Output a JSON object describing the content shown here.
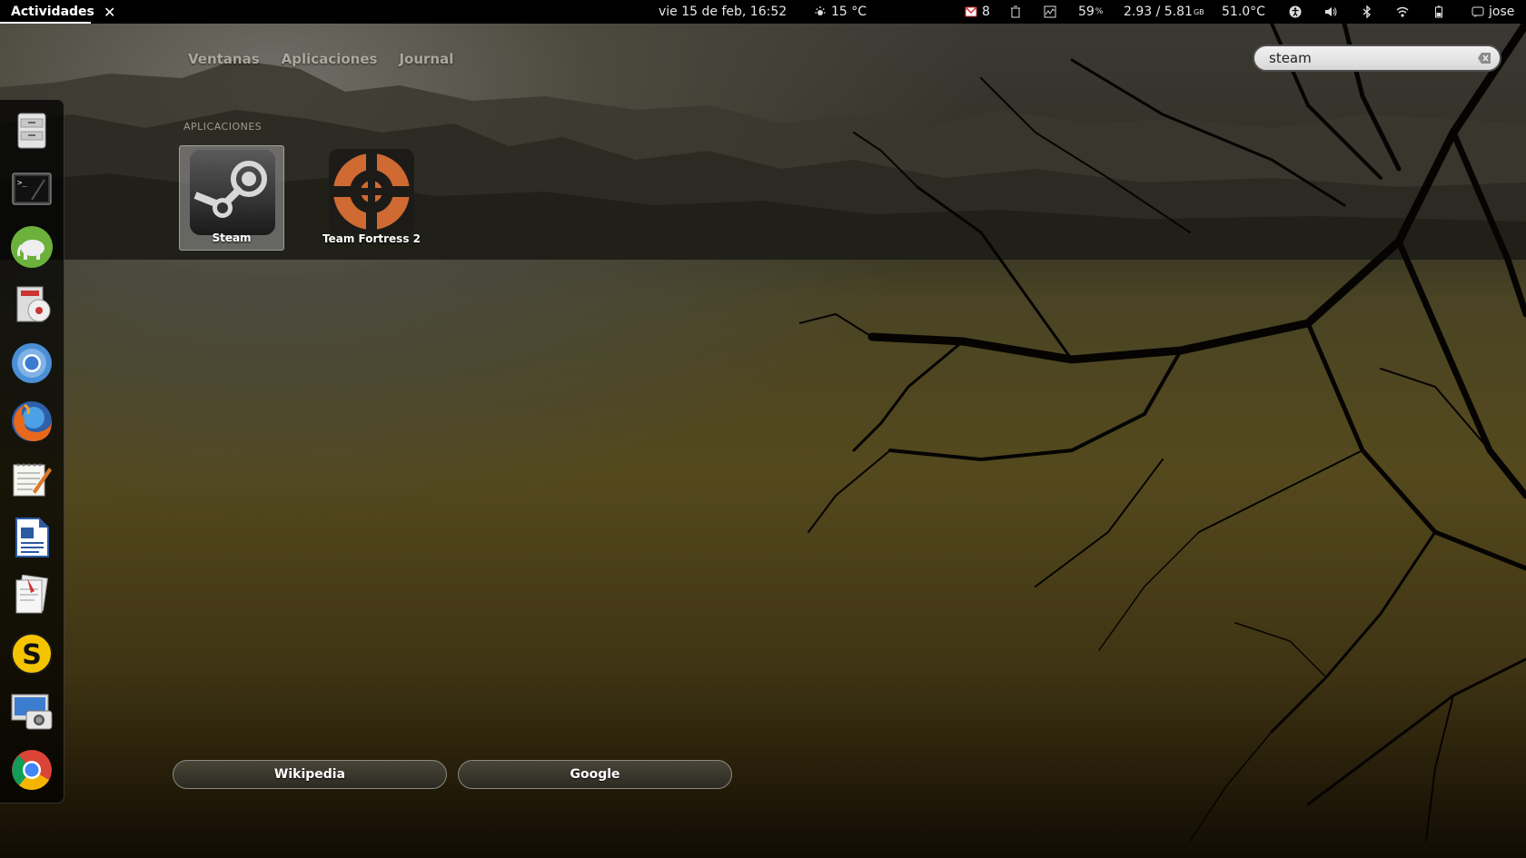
{
  "topbar": {
    "activities": "Actividades",
    "close_symbol": "✕",
    "clock": "vie 15 de feb, 16:52",
    "weather": "15 °C",
    "gmail_count": "8",
    "cpu_percent": "59",
    "cpu_unit": "%",
    "load": "2.93 / 5.81",
    "load_unit": "GB",
    "temperature": "51.0°C",
    "user": "jose"
  },
  "tabs": [
    "Ventanas",
    "Aplicaciones",
    "Journal"
  ],
  "search": {
    "value": "steam"
  },
  "results": {
    "section": "APLICACIONES",
    "apps": [
      {
        "label": "Steam",
        "icon": "steam-icon"
      },
      {
        "label": "Team Fortress 2",
        "icon": "tf2-icon"
      }
    ]
  },
  "providers": [
    "Wikipedia",
    "Google"
  ],
  "dash": [
    "files-icon",
    "terminal-icon",
    "evernote-icon",
    "disc-burner-icon",
    "chromium-icon",
    "firefox-icon",
    "text-editor-icon",
    "writer-icon",
    "documents-icon",
    "skype-icon",
    "screenshot-icon",
    "chrome-icon"
  ]
}
